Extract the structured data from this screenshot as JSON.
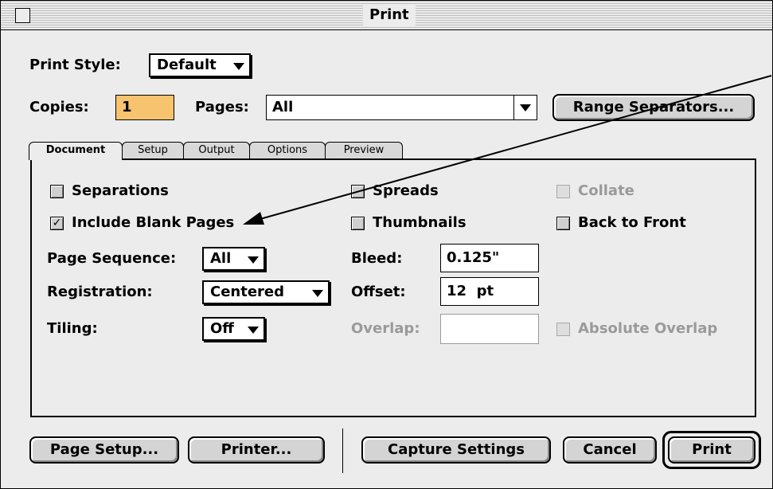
{
  "window": {
    "title": "Print"
  },
  "print_style": {
    "label": "Print Style:",
    "value": "Default"
  },
  "copies": {
    "label": "Copies:",
    "value": "1"
  },
  "pages": {
    "label": "Pages:",
    "value": "All"
  },
  "range_separators_label": "Range Separators...",
  "tabs": [
    {
      "label": "Document",
      "active": true
    },
    {
      "label": "Setup",
      "active": false
    },
    {
      "label": "Output",
      "active": false
    },
    {
      "label": "Options",
      "active": false
    },
    {
      "label": "Preview",
      "active": false
    }
  ],
  "document": {
    "separations": {
      "label": "Separations",
      "checked": false
    },
    "include_blank_pages": {
      "label": "Include Blank Pages",
      "checked": true
    },
    "spreads": {
      "label": "Spreads",
      "checked": false
    },
    "thumbnails": {
      "label": "Thumbnails",
      "checked": false
    },
    "collate": {
      "label": "Collate",
      "checked": false,
      "enabled": false
    },
    "back_to_front": {
      "label": "Back to Front",
      "checked": false
    },
    "page_sequence": {
      "label": "Page Sequence:",
      "value": "All"
    },
    "registration": {
      "label": "Registration:",
      "value": "Centered"
    },
    "tiling": {
      "label": "Tiling:",
      "value": "Off"
    },
    "bleed": {
      "label": "Bleed:",
      "value": "0.125\""
    },
    "offset": {
      "label": "Offset:",
      "value": "12  pt"
    },
    "overlap": {
      "label": "Overlap:",
      "value": "",
      "enabled": false
    },
    "absolute_overlap": {
      "label": "Absolute Overlap",
      "checked": false,
      "enabled": false
    }
  },
  "buttons": {
    "page_setup": "Page Setup...",
    "printer": "Printer...",
    "capture_settings": "Capture Settings",
    "cancel": "Cancel",
    "print": "Print"
  },
  "icons": {
    "checkmark": "✓",
    "dropdown": "triangle-down-icon"
  }
}
